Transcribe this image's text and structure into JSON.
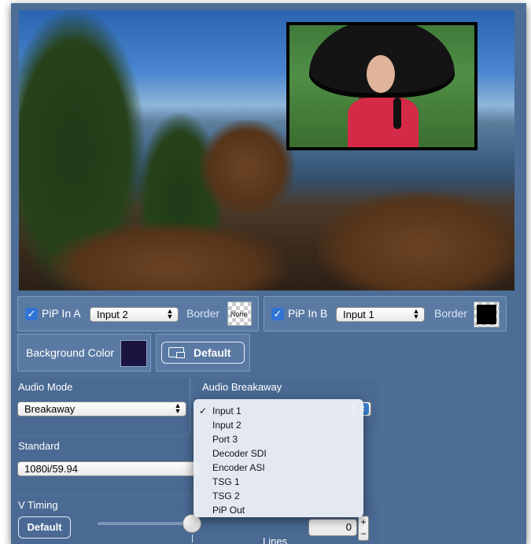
{
  "pip_a": {
    "enabled": true,
    "label": "PiP In A",
    "input": "Input 2",
    "border_label": "Border",
    "border_swatch": "None"
  },
  "pip_b": {
    "enabled": true,
    "label": "PiP In B",
    "input": "Input 1",
    "border_label": "Border"
  },
  "background": {
    "label": "Background Color",
    "color": "#1b1440",
    "default_button": "Default"
  },
  "audio": {
    "mode_header": "Audio Mode",
    "mode_value": "Breakaway",
    "breakaway_header": "Audio Breakaway",
    "breakaway_options": [
      "Input 1",
      "Input 2",
      "Port 3",
      "Decoder SDI",
      "Encoder ASI",
      "TSG 1",
      "TSG 2",
      "PiP Out"
    ],
    "breakaway_selected": "Input 1"
  },
  "standard": {
    "header": "Standard",
    "value": "1080i/59.94"
  },
  "vtiming": {
    "header": "V Timing",
    "default_button": "Default",
    "lines_value": "0",
    "lines_label": "Lines"
  },
  "colors": {
    "panel_bg": "#4d6d96",
    "accent_check": "#2f73d6"
  },
  "icons": {
    "checkbox": "checkmark-icon",
    "select": "updown-chevron-icon",
    "default": "window-layout-icon",
    "stepper": "plus-minus-stepper-icon"
  }
}
